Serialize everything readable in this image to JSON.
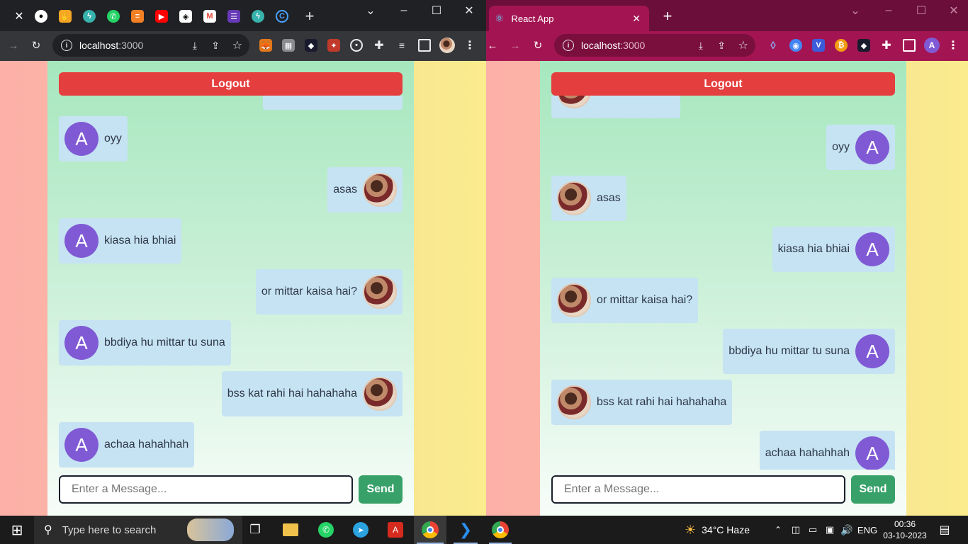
{
  "left_window": {
    "tabs": [
      "close-tab-icon",
      "github-icon",
      "fire-icon",
      "lightning-icon",
      "whatsapp-icon",
      "stackoverflow-icon",
      "youtube-icon",
      "codepen-icon",
      "gmail-icon",
      "forms-icon",
      "lightning-icon",
      "loop-icon"
    ],
    "address": {
      "host": "localhost",
      "port": ":3000"
    },
    "logout_label": "Logout",
    "messages": [
      {
        "side": "left",
        "avatar": "A",
        "text": "oyy"
      },
      {
        "side": "right",
        "avatar": "photo",
        "text": "asas"
      },
      {
        "side": "left",
        "avatar": "A",
        "text": "kiasa hia bhiai"
      },
      {
        "side": "right",
        "avatar": "photo",
        "text": "or mittar kaisa hai?"
      },
      {
        "side": "left",
        "avatar": "A",
        "text": "bbdiya hu mittar tu suna"
      },
      {
        "side": "right",
        "avatar": "photo",
        "text": "bss kat rahi hai hahahaha"
      },
      {
        "side": "left",
        "avatar": "A",
        "text": "achaa hahahhah"
      }
    ],
    "input_placeholder": "Enter a Message...",
    "send_label": "Send"
  },
  "right_window": {
    "tab_title": "React App",
    "address": {
      "host": "localhost",
      "port": ":3000"
    },
    "profile_initial": "A",
    "logout_label": "Logout",
    "messages": [
      {
        "side": "right",
        "avatar": "A",
        "text": "oyy"
      },
      {
        "side": "left",
        "avatar": "photo",
        "text": "asas"
      },
      {
        "side": "right",
        "avatar": "A",
        "text": "kiasa hia bhiai"
      },
      {
        "side": "left",
        "avatar": "photo",
        "text": "or mittar kaisa hai?"
      },
      {
        "side": "right",
        "avatar": "A",
        "text": "bbdiya hu mittar tu suna"
      },
      {
        "side": "left",
        "avatar": "photo",
        "text": "bss kat rahi hai hahahaha"
      },
      {
        "side": "right",
        "avatar": "A",
        "text": "achaa hahahhah"
      }
    ],
    "input_placeholder": "Enter a Message...",
    "send_label": "Send"
  },
  "taskbar": {
    "search_placeholder": "Type here to search",
    "weather": "34°C  Haze",
    "language": "ENG",
    "time": "00:36",
    "date": "03-10-2023"
  },
  "colors": {
    "logout": "#e53e3e",
    "send": "#38a169",
    "bubble": "#c6e3f3",
    "avatar_a": "#805ad5"
  }
}
